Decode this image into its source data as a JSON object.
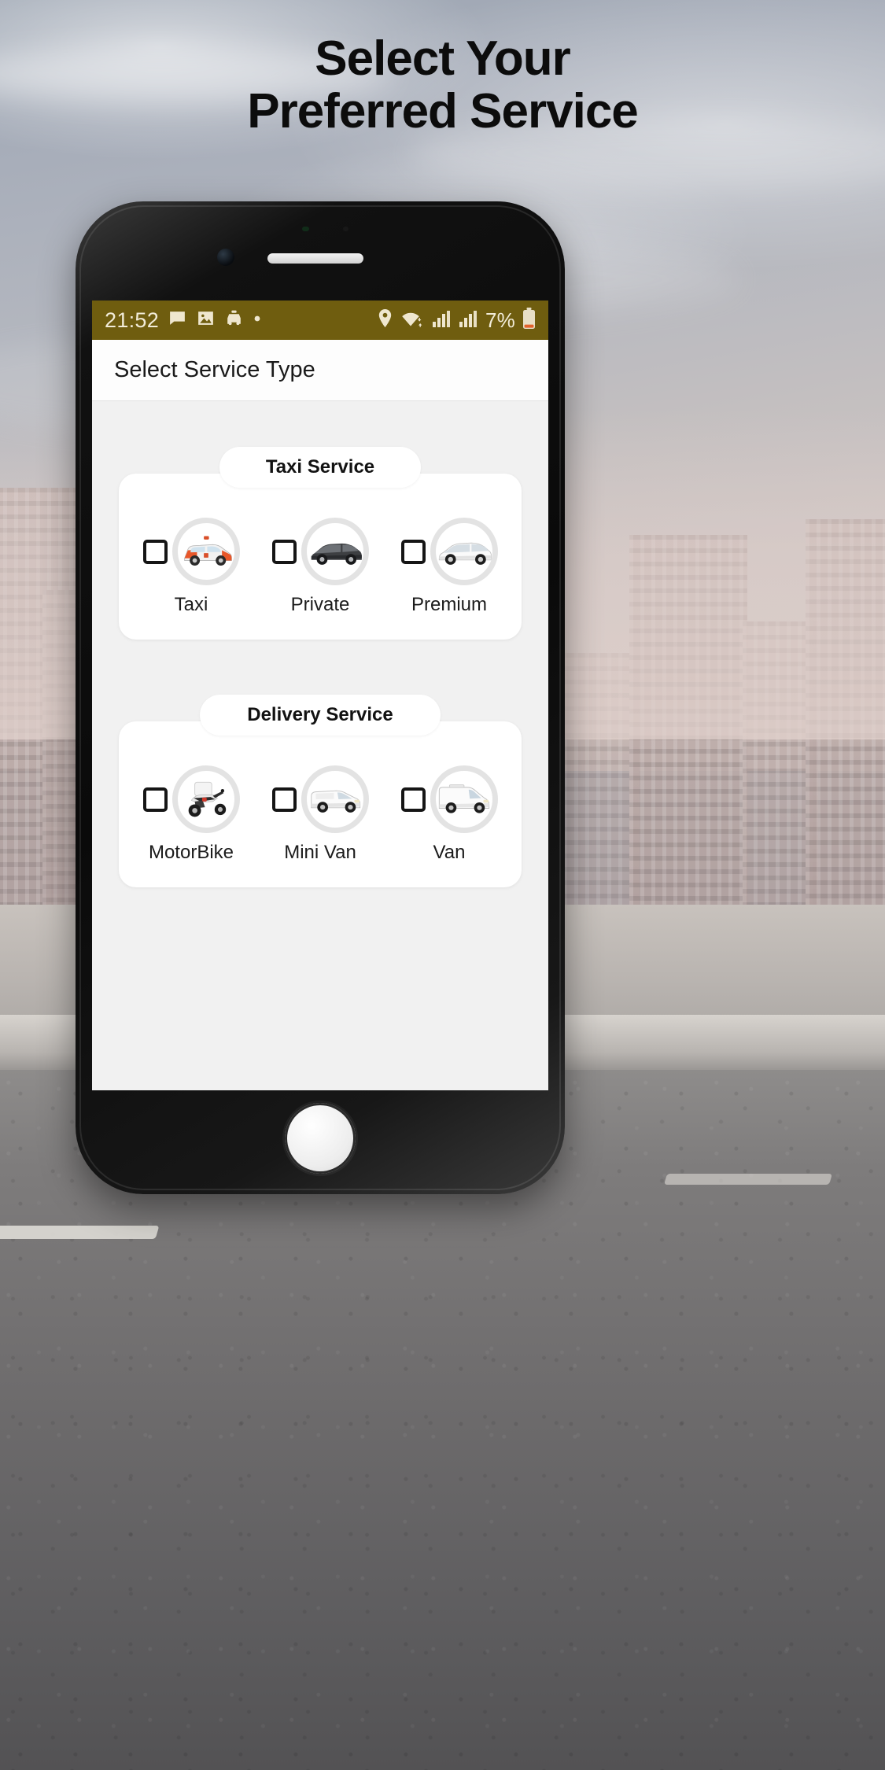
{
  "headline": {
    "line1": "Select Your",
    "line2": "Preferred Service"
  },
  "colors": {
    "status_bar_bg": "#6f5d0f",
    "status_bar_text": "#f2ecd8",
    "app_bar_bg": "#fdfdfd",
    "content_bg": "#f1f1f1",
    "card_bg": "#ffffff",
    "checkbox_border": "#151515",
    "thumb_ring": "#e3e3e3",
    "battery_low": "#e2622c",
    "headline_text": "#0c0c0c"
  },
  "status_bar": {
    "time": "21:52",
    "left_icons": [
      "message-icon",
      "image-icon",
      "taxi-icon",
      "dot-more-icon"
    ],
    "right_icons": [
      "location-pin-icon",
      "wifi-icon",
      "signal-bars-icon",
      "signal-bars-2-icon"
    ],
    "battery_percent": "7%",
    "battery_icon": "battery-low-icon"
  },
  "app_bar": {
    "title": "Select Service Type"
  },
  "sections": [
    {
      "pill_label": "Taxi Service",
      "options": [
        {
          "label": "Taxi",
          "icon": "taxi-car-icon",
          "checked": false
        },
        {
          "label": "Private",
          "icon": "sedan-dark-icon",
          "checked": false
        },
        {
          "label": "Premium",
          "icon": "sedan-white-icon",
          "checked": false
        }
      ]
    },
    {
      "pill_label": "Delivery Service",
      "options": [
        {
          "label": "MotorBike",
          "icon": "scooter-icon",
          "checked": false
        },
        {
          "label": "Mini Van",
          "icon": "mini-van-icon",
          "checked": false
        },
        {
          "label": "Van",
          "icon": "van-icon",
          "checked": false
        }
      ]
    }
  ]
}
